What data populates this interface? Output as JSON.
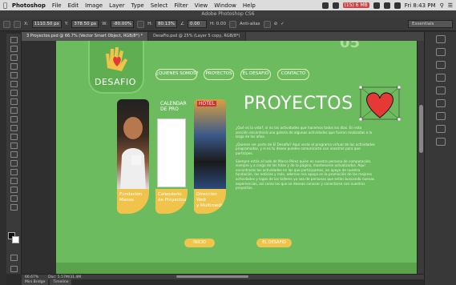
{
  "menubar": {
    "app_name": "Photoshop",
    "menus": [
      "File",
      "Edit",
      "Image",
      "Layer",
      "Type",
      "Select",
      "Filter",
      "View",
      "Window",
      "Help"
    ],
    "battery": "(15) 6 MB",
    "clock": "Fri 8:43 PM"
  },
  "window": {
    "title": "Adobe Photoshop CS6"
  },
  "options": {
    "x_value": "1110.50 px",
    "y_value": "378.50 px",
    "w_value": "-80.00%",
    "h_value": "80.13%",
    "angle_value": "0.00",
    "antialias_label": "Anti-alias",
    "workspace": "Essentials"
  },
  "tabs": [
    {
      "label": "3 Proyectos.psd @ 66.7% (Vector Smart Object, RGB/8*) *",
      "active": true
    },
    {
      "label": "DesaFio.psd @ 25% (Layer 5 copy, RGB/8*)",
      "active": false
    }
  ],
  "colors": {
    "page_green": "#6dbb5f",
    "accent_yellow": "#f0c44a",
    "heart_red": "#e53935"
  },
  "site": {
    "top_partial_text": "05",
    "logo_text": "DESAFIO",
    "nav": [
      "¿QUIENES SOMOS?",
      "PROYECTOS",
      "EL DESAFIO",
      "CONTACTO"
    ],
    "title": "PROYECTOS",
    "cards": [
      {
        "label_line1": "Fundación",
        "label_line2": "Manos"
      },
      {
        "label_line1": "Calendario",
        "label_line2": "de Proyectos",
        "overlay": "CALENDAR DE PRO"
      },
      {
        "label_line1": "Dirección Web",
        "label_line2": "y Multimedia",
        "overlay": "HOTEL"
      }
    ],
    "paragraphs": [
      "¿Qué es la vida?, si no las actividades que hacemos todos los días. En esta sección encontrará una galería de algunas actividades que fueron realizadas a lo largo de los años.",
      "¿Quieres ser parte de El Desafío? Aquí verás el programa virtual de las actividades programadas, y si es tu deseo puedes comunicarte con nosotros para que participes.",
      "Siempre estás al lado de Marco Pérez quien es nuestra persona de computación, siempre y a cargo de las fotos y de la página, mantenerse actualizados. Aquí encontrarás las actividades en las que participamos, en apoyo de nuestra fundación, las noticias y más, ademas nos apoya en la promoción de las mejores actividades y logos de los talleres ya sea de personas que están buscando nuevas experiencias, así como los que se desean conocer y conectarse con nuestros proyectos."
    ],
    "buttons": [
      "INICIO",
      "EL DESAFIO"
    ]
  },
  "status": {
    "zoom": "66.67%",
    "doc": "Doc: 5.57M/31.4M"
  },
  "bottom_tabs": [
    "Mini Bridge",
    "Timeline"
  ]
}
